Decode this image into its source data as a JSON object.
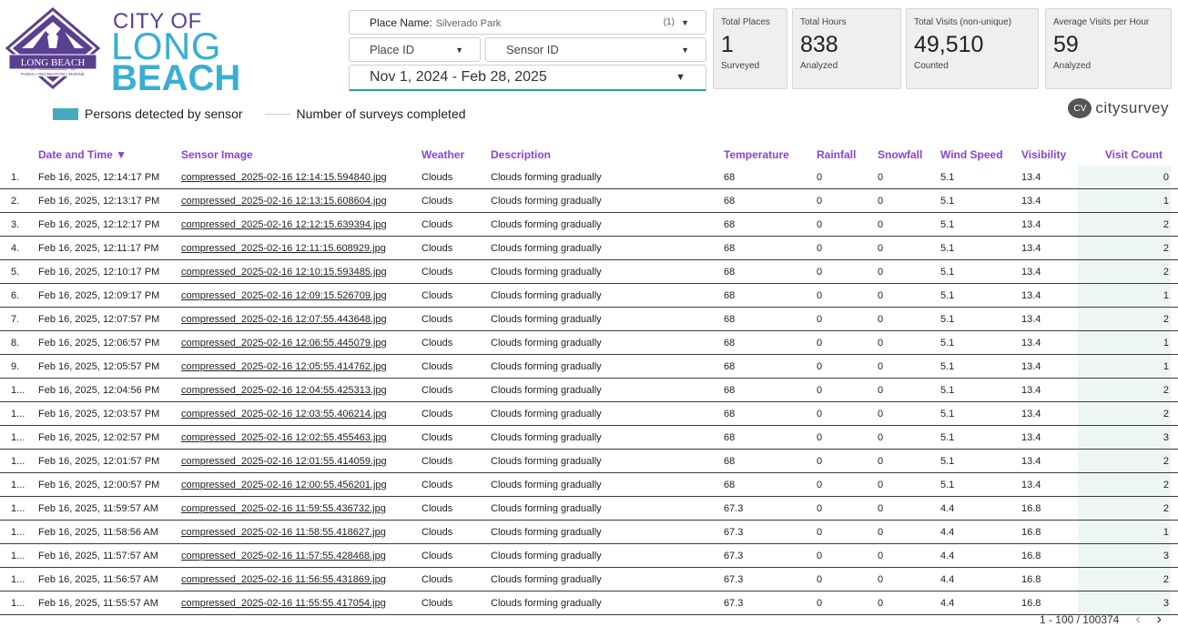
{
  "logo": {
    "city_of": "CITY OF",
    "long": "LONG",
    "beach": "BEACH",
    "badge_main": "LONG BEACH",
    "badge_sub": "PARKS • RECREATION • MARINE"
  },
  "filters": {
    "place_label": "Place Name:",
    "place_value": "Silverado Park",
    "place_count": "(1)",
    "place_id_label": "Place ID",
    "sensor_id_label": "Sensor ID",
    "date_range": "Nov 1, 2024 - Feb 28, 2025"
  },
  "cards": [
    {
      "title": "Total Places",
      "value": "1",
      "sub": "Surveyed"
    },
    {
      "title": "Total Hours",
      "value": "838",
      "sub": "Analyzed"
    },
    {
      "title": "Total Visits (non-unique)",
      "value": "49,510",
      "sub": "Counted"
    },
    {
      "title": "Average Visits per Hour",
      "value": "59",
      "sub": "Analyzed"
    }
  ],
  "legend": {
    "persons": "Persons detected by sensor",
    "surveys": "Number of surveys completed"
  },
  "brand": {
    "cv": "CV",
    "text": "citysurvey"
  },
  "table": {
    "headers": {
      "date": "Date and Time ▼",
      "image": "Sensor Image",
      "weather": "Weather",
      "description": "Description",
      "temperature": "Temperature",
      "rainfall": "Rainfall",
      "snowfall": "Snowfall",
      "wind": "Wind Speed",
      "visibility": "Visibility",
      "visits": "Visit Count"
    },
    "rows": [
      {
        "idx": "1.",
        "date": "Feb 16, 2025, 12:14:17 PM",
        "image": "compressed_2025-02-16 12:14:15.594840.jpg",
        "weather": "Clouds",
        "desc": "Clouds forming gradually",
        "temp": "68",
        "rain": "0",
        "snow": "0",
        "wind": "5.1",
        "vis": "13.4",
        "visits": "0"
      },
      {
        "idx": "2.",
        "date": "Feb 16, 2025, 12:13:17 PM",
        "image": "compressed_2025-02-16 12:13:15.608604.jpg",
        "weather": "Clouds",
        "desc": "Clouds forming gradually",
        "temp": "68",
        "rain": "0",
        "snow": "0",
        "wind": "5.1",
        "vis": "13.4",
        "visits": "1"
      },
      {
        "idx": "3.",
        "date": "Feb 16, 2025, 12:12:17 PM",
        "image": "compressed_2025-02-16 12:12:15.639394.jpg",
        "weather": "Clouds",
        "desc": "Clouds forming gradually",
        "temp": "68",
        "rain": "0",
        "snow": "0",
        "wind": "5.1",
        "vis": "13.4",
        "visits": "2"
      },
      {
        "idx": "4.",
        "date": "Feb 16, 2025, 12:11:17 PM",
        "image": "compressed_2025-02-16 12:11:15.608929.jpg",
        "weather": "Clouds",
        "desc": "Clouds forming gradually",
        "temp": "68",
        "rain": "0",
        "snow": "0",
        "wind": "5.1",
        "vis": "13.4",
        "visits": "2"
      },
      {
        "idx": "5.",
        "date": "Feb 16, 2025, 12:10:17 PM",
        "image": "compressed_2025-02-16 12:10:15.593485.jpg",
        "weather": "Clouds",
        "desc": "Clouds forming gradually",
        "temp": "68",
        "rain": "0",
        "snow": "0",
        "wind": "5.1",
        "vis": "13.4",
        "visits": "2"
      },
      {
        "idx": "6.",
        "date": "Feb 16, 2025, 12:09:17 PM",
        "image": "compressed_2025-02-16 12:09:15.526709.jpg",
        "weather": "Clouds",
        "desc": "Clouds forming gradually",
        "temp": "68",
        "rain": "0",
        "snow": "0",
        "wind": "5.1",
        "vis": "13.4",
        "visits": "1"
      },
      {
        "idx": "7.",
        "date": "Feb 16, 2025, 12:07:57 PM",
        "image": "compressed_2025-02-16 12:07:55.443648.jpg",
        "weather": "Clouds",
        "desc": "Clouds forming gradually",
        "temp": "68",
        "rain": "0",
        "snow": "0",
        "wind": "5.1",
        "vis": "13.4",
        "visits": "2"
      },
      {
        "idx": "8.",
        "date": "Feb 16, 2025, 12:06:57 PM",
        "image": "compressed_2025-02-16 12:06:55.445079.jpg",
        "weather": "Clouds",
        "desc": "Clouds forming gradually",
        "temp": "68",
        "rain": "0",
        "snow": "0",
        "wind": "5.1",
        "vis": "13.4",
        "visits": "1"
      },
      {
        "idx": "9.",
        "date": "Feb 16, 2025, 12:05:57 PM",
        "image": "compressed_2025-02-16 12:05:55.414762.jpg",
        "weather": "Clouds",
        "desc": "Clouds forming gradually",
        "temp": "68",
        "rain": "0",
        "snow": "0",
        "wind": "5.1",
        "vis": "13.4",
        "visits": "1"
      },
      {
        "idx": "1...",
        "date": "Feb 16, 2025, 12:04:56 PM",
        "image": "compressed_2025-02-16 12:04:55.425313.jpg",
        "weather": "Clouds",
        "desc": "Clouds forming gradually",
        "temp": "68",
        "rain": "0",
        "snow": "0",
        "wind": "5.1",
        "vis": "13.4",
        "visits": "2"
      },
      {
        "idx": "1...",
        "date": "Feb 16, 2025, 12:03:57 PM",
        "image": "compressed_2025-02-16 12:03:55.406214.jpg",
        "weather": "Clouds",
        "desc": "Clouds forming gradually",
        "temp": "68",
        "rain": "0",
        "snow": "0",
        "wind": "5.1",
        "vis": "13.4",
        "visits": "2"
      },
      {
        "idx": "1...",
        "date": "Feb 16, 2025, 12:02:57 PM",
        "image": "compressed_2025-02-16 12:02:55.455463.jpg",
        "weather": "Clouds",
        "desc": "Clouds forming gradually",
        "temp": "68",
        "rain": "0",
        "snow": "0",
        "wind": "5.1",
        "vis": "13.4",
        "visits": "3"
      },
      {
        "idx": "1...",
        "date": "Feb 16, 2025, 12:01:57 PM",
        "image": "compressed_2025-02-16 12:01:55.414059.jpg",
        "weather": "Clouds",
        "desc": "Clouds forming gradually",
        "temp": "68",
        "rain": "0",
        "snow": "0",
        "wind": "5.1",
        "vis": "13.4",
        "visits": "2"
      },
      {
        "idx": "1...",
        "date": "Feb 16, 2025, 12:00:57 PM",
        "image": "compressed_2025-02-16 12:00:55.456201.jpg",
        "weather": "Clouds",
        "desc": "Clouds forming gradually",
        "temp": "68",
        "rain": "0",
        "snow": "0",
        "wind": "5.1",
        "vis": "13.4",
        "visits": "2"
      },
      {
        "idx": "1...",
        "date": "Feb 16, 2025, 11:59:57 AM",
        "image": "compressed_2025-02-16 11:59:55.436732.jpg",
        "weather": "Clouds",
        "desc": "Clouds forming gradually",
        "temp": "67.3",
        "rain": "0",
        "snow": "0",
        "wind": "4.4",
        "vis": "16.8",
        "visits": "2"
      },
      {
        "idx": "1...",
        "date": "Feb 16, 2025, 11:58:56 AM",
        "image": "compressed_2025-02-16 11:58:55.418627.jpg",
        "weather": "Clouds",
        "desc": "Clouds forming gradually",
        "temp": "67.3",
        "rain": "0",
        "snow": "0",
        "wind": "4.4",
        "vis": "16.8",
        "visits": "1"
      },
      {
        "idx": "1...",
        "date": "Feb 16, 2025, 11:57:57 AM",
        "image": "compressed_2025-02-16 11:57:55.428468.jpg",
        "weather": "Clouds",
        "desc": "Clouds forming gradually",
        "temp": "67.3",
        "rain": "0",
        "snow": "0",
        "wind": "4.4",
        "vis": "16.8",
        "visits": "3"
      },
      {
        "idx": "1...",
        "date": "Feb 16, 2025, 11:56:57 AM",
        "image": "compressed_2025-02-16 11:56:55.431869.jpg",
        "weather": "Clouds",
        "desc": "Clouds forming gradually",
        "temp": "67.3",
        "rain": "0",
        "snow": "0",
        "wind": "4.4",
        "vis": "16.8",
        "visits": "2"
      },
      {
        "idx": "1...",
        "date": "Feb 16, 2025, 11:55:57 AM",
        "image": "compressed_2025-02-16 11:55:55.417054.jpg",
        "weather": "Clouds",
        "desc": "Clouds forming gradually",
        "temp": "67.3",
        "rain": "0",
        "snow": "0",
        "wind": "4.4",
        "vis": "16.8",
        "visits": "3"
      }
    ]
  },
  "pager": {
    "range": "1 - 100 / 100374",
    "prev": "‹",
    "next": "›"
  },
  "colors": {
    "header_purple": "#8d3fd8",
    "accent_teal": "#46a9bd",
    "logo_purple": "#5b3f91",
    "logo_blue": "#3aaed3"
  }
}
